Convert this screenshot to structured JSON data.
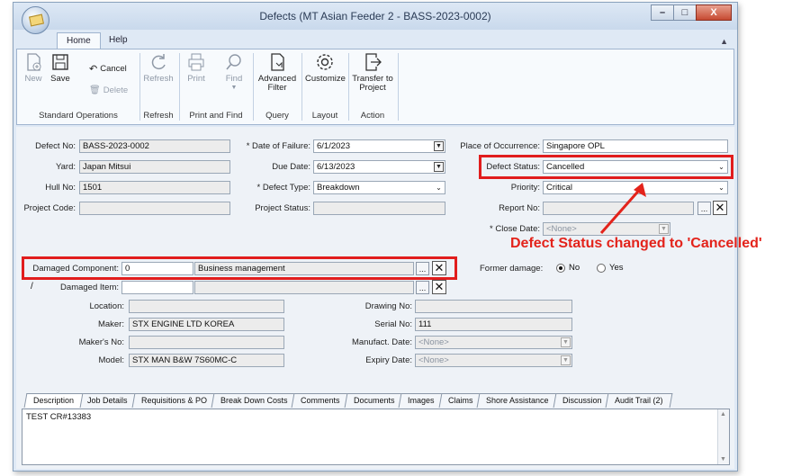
{
  "window": {
    "title": "Defects (MT Asian Feeder 2 - BASS-2023-0002)",
    "controls": {
      "minimize": "–",
      "maximize": "□",
      "close": "X"
    }
  },
  "ribbon_tabs": [
    "Home",
    "Help"
  ],
  "ribbon": {
    "new": "New",
    "save": "Save",
    "cancel": "Cancel",
    "delete": "Delete",
    "refresh": "Refresh",
    "print": "Print",
    "find": "Find",
    "advanced_filter_1": "Advanced",
    "advanced_filter_2": "Filter",
    "customize": "Customize",
    "transfer_1": "Transfer to",
    "transfer_2": "Project",
    "groups": [
      "Standard Operations",
      "Refresh",
      "Print and Find",
      "Query",
      "Layout",
      "Action"
    ]
  },
  "form": {
    "defect_no_label": "Defect No:",
    "defect_no": "BASS-2023-0002",
    "yard_label": "Yard:",
    "yard": "Japan Mitsui",
    "hull_no_label": "Hull No:",
    "hull_no": "1501",
    "project_code_label": "Project Code:",
    "project_code": "",
    "date_of_failure_label": "* Date of Failure:",
    "date_of_failure": "6/1/2023",
    "due_date_label": "Due Date:",
    "due_date": "6/13/2023",
    "defect_type_label": "* Defect Type:",
    "defect_type": "Breakdown",
    "project_status_label": "Project Status:",
    "project_status": "",
    "place_label": "Place of Occurrence:",
    "place": "Singapore OPL",
    "defect_status_label": "Defect Status:",
    "defect_status": "Cancelled",
    "priority_label": "Priority:",
    "priority": "Critical",
    "report_no_label": "Report No:",
    "report_no": "",
    "close_date_label": "* Close Date:",
    "close_date": "<None>",
    "damaged_component_label": "Damaged Component:",
    "damaged_component_code": "0",
    "damaged_component_name": "Business management",
    "damaged_item_label": "Damaged Item:",
    "damaged_item": "",
    "former_damage_label": "Former damage:",
    "former_damage_options": [
      "No",
      "Yes"
    ],
    "former_damage_selected": "No",
    "location_label": "Location:",
    "location": "",
    "maker_label": "Maker:",
    "maker": "STX ENGINE LTD KOREA",
    "makers_no_label": "Maker's No:",
    "makers_no": "",
    "model_label": "Model:",
    "model": "STX MAN B&W 7S60MC-C",
    "drawing_no_label": "Drawing No:",
    "drawing_no": "",
    "serial_no_label": "Serial No:",
    "serial_no": "111",
    "manufact_date_label": "Manufact. Date:",
    "manufact_date": "<None>",
    "expiry_date_label": "Expiry Date:",
    "expiry_date": "<None>"
  },
  "annotation": "Defect Status changed to 'Cancelled'",
  "bottom_tabs": [
    "Description",
    "Job Details",
    "Requisitions & PO",
    "Break Down Costs",
    "Comments",
    "Documents",
    "Images",
    "Claims",
    "Shore Assistance",
    "Discussion",
    "Audit Trail (2)"
  ],
  "description_text": "TEST CR#13383",
  "colors": {
    "highlight": "#e11d1d",
    "annotation": "#e3231b",
    "window_frame": "#dfe9f5"
  }
}
